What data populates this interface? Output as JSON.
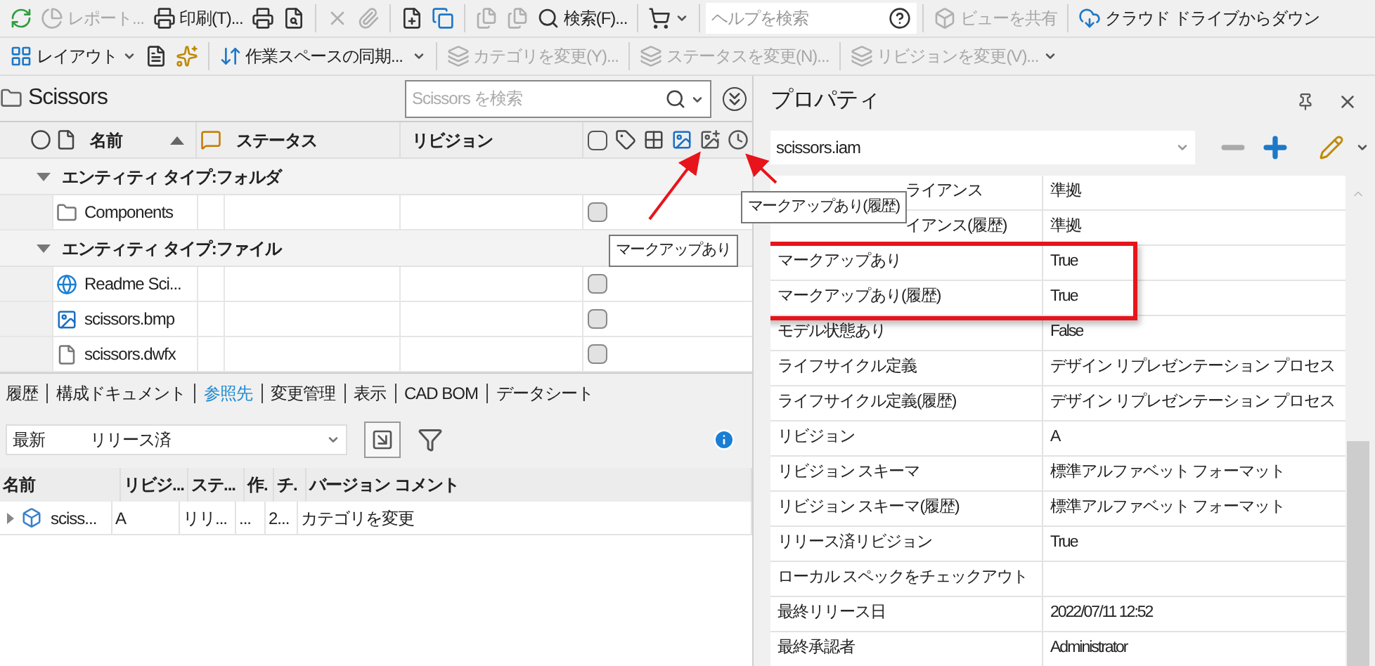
{
  "toolbar": {
    "rows": [
      [
        {
          "kind": "button"
        },
        {
          "kind": "button",
          "label": "レポート...",
          "disabled": true
        },
        {
          "kind": "button",
          "label": "印刷(T)..."
        },
        {
          "kind": "button"
        },
        {
          "kind": "button"
        },
        {
          "kind": "separator"
        },
        {
          "kind": "button",
          "disabled": true
        },
        {
          "kind": "button",
          "disabled": true
        },
        {
          "kind": "separator"
        },
        {
          "kind": "button"
        },
        {
          "kind": "button"
        },
        {
          "kind": "separator"
        },
        {
          "kind": "button",
          "disabled": true
        },
        {
          "kind": "button",
          "disabled": true
        },
        {
          "kind": "button",
          "label": "検索(F)..."
        },
        {
          "kind": "separator"
        },
        {
          "kind": "split"
        },
        {
          "kind": "separator"
        },
        {
          "kind": "search",
          "placeholder": "ヘルプを検索"
        },
        {
          "kind": "separator"
        },
        {
          "kind": "button",
          "label": "ビューを共有",
          "disabled": true
        },
        {
          "kind": "separator"
        },
        {
          "kind": "button",
          "label": "クラウド ドライブからダウン"
        }
      ],
      [
        {
          "kind": "split",
          "label": "レイアウト"
        },
        {
          "kind": "button"
        },
        {
          "kind": "button"
        },
        {
          "kind": "separator"
        },
        {
          "kind": "button",
          "label": "作業スペースの同期..."
        },
        {
          "kind": "split"
        },
        {
          "kind": "separator"
        },
        {
          "kind": "button",
          "label": "カテゴリを変更(Y)...",
          "disabled": true
        },
        {
          "kind": "separator"
        },
        {
          "kind": "button",
          "label": "ステータスを変更(N)...",
          "disabled": true
        },
        {
          "kind": "separator"
        },
        {
          "kind": "split",
          "label": "リビジョンを変更(V)...",
          "disabled": true
        }
      ]
    ]
  },
  "folder": {
    "title": "Scissors",
    "search_placeholder": "Scissors を検索",
    "columns": [
      {
        "label": "名前",
        "sorted": true
      },
      {
        "label": "ステータス",
        "sorted": false
      },
      {
        "label": "リビジョン",
        "sorted": false
      }
    ],
    "groups": [
      {
        "label": "エンティティ タイプ:フォルダ",
        "expanded": true,
        "rows": [
          {
            "name": "Components",
            "kind": "folder",
            "checked": false
          }
        ]
      },
      {
        "label": "エンティティ タイプ:ファイル",
        "expanded": true,
        "rows": [
          {
            "name": "Readme Sci...",
            "kind": "web",
            "checked": false
          },
          {
            "name": "scissors.bmp",
            "kind": "image",
            "checked": false
          },
          {
            "name": "scissors.dwfx",
            "kind": "file",
            "checked": false
          }
        ]
      }
    ],
    "tooltips": [
      {
        "text": "マークアップあり(履歴)"
      },
      {
        "text": "マークアップあり"
      }
    ]
  },
  "detail_tabs": [
    {
      "label": "履歴",
      "selected": false
    },
    {
      "label": "構成ドキュメント",
      "selected": false
    },
    {
      "label": "参照先",
      "selected": true
    },
    {
      "label": "変更管理",
      "selected": false
    },
    {
      "label": "表示",
      "selected": false
    },
    {
      "label": "CAD BOM",
      "selected": false
    },
    {
      "label": "データシート",
      "selected": false
    }
  ],
  "filter": {
    "version": "最新",
    "state": "リリース済"
  },
  "uses_table": {
    "columns": [
      "名前",
      "リビジ...",
      "ステ...",
      "作.",
      "チ.",
      "バージョン コメント"
    ],
    "rows": [
      {
        "expanded": false,
        "cells": [
          "sciss...",
          "A",
          "リリ...",
          "...",
          "2...",
          "カテゴリを変更"
        ]
      }
    ]
  },
  "properties": {
    "title": "プロパティ",
    "file": "scissors.iam",
    "rows": [
      {
        "name": "ライアンス",
        "value": "準拠",
        "highlighted": false
      },
      {
        "name": "イアンス(履歴)",
        "value": "準拠",
        "highlighted": false
      },
      {
        "name": "マークアップあり",
        "value": "True",
        "highlighted": true
      },
      {
        "name": "マークアップあり(履歴)",
        "value": "True",
        "highlighted": true
      },
      {
        "name": "モデル状態あり",
        "value": "False",
        "highlighted": false
      },
      {
        "name": "ライフサイクル定義",
        "value": "デザイン リプレゼンテーション プロセス",
        "highlighted": false
      },
      {
        "name": "ライフサイクル定義(履歴)",
        "value": "デザイン リプレゼンテーション プロセス",
        "highlighted": false
      },
      {
        "name": "リビジョン",
        "value": "A",
        "highlighted": false
      },
      {
        "name": "リビジョン スキーマ",
        "value": "標準アルファベット フォーマット",
        "highlighted": false
      },
      {
        "name": "リビジョン スキーマ(履歴)",
        "value": "標準アルファベット フォーマット",
        "highlighted": false
      },
      {
        "name": "リリース済リビジョン",
        "value": "True",
        "highlighted": false
      },
      {
        "name": "ローカル スペックをチェックアウト",
        "highlighted": false
      },
      {
        "name": "最終リリース日",
        "value": "2022/07/11 12:52",
        "highlighted": false
      },
      {
        "name": "最終承認者",
        "value": "Administrator",
        "highlighted": false
      }
    ]
  }
}
